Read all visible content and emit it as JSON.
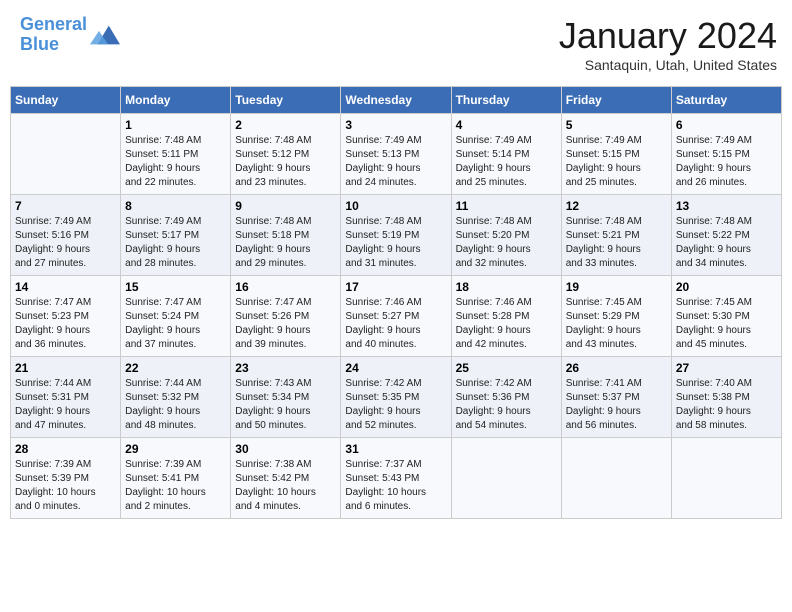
{
  "header": {
    "logo_line1": "General",
    "logo_line2": "Blue",
    "month_title": "January 2024",
    "location": "Santaquin, Utah, United States"
  },
  "days_of_week": [
    "Sunday",
    "Monday",
    "Tuesday",
    "Wednesday",
    "Thursday",
    "Friday",
    "Saturday"
  ],
  "weeks": [
    [
      {
        "day": "",
        "info": ""
      },
      {
        "day": "1",
        "info": "Sunrise: 7:48 AM\nSunset: 5:11 PM\nDaylight: 9 hours\nand 22 minutes."
      },
      {
        "day": "2",
        "info": "Sunrise: 7:48 AM\nSunset: 5:12 PM\nDaylight: 9 hours\nand 23 minutes."
      },
      {
        "day": "3",
        "info": "Sunrise: 7:49 AM\nSunset: 5:13 PM\nDaylight: 9 hours\nand 24 minutes."
      },
      {
        "day": "4",
        "info": "Sunrise: 7:49 AM\nSunset: 5:14 PM\nDaylight: 9 hours\nand 25 minutes."
      },
      {
        "day": "5",
        "info": "Sunrise: 7:49 AM\nSunset: 5:15 PM\nDaylight: 9 hours\nand 25 minutes."
      },
      {
        "day": "6",
        "info": "Sunrise: 7:49 AM\nSunset: 5:15 PM\nDaylight: 9 hours\nand 26 minutes."
      }
    ],
    [
      {
        "day": "7",
        "info": "Sunrise: 7:49 AM\nSunset: 5:16 PM\nDaylight: 9 hours\nand 27 minutes."
      },
      {
        "day": "8",
        "info": "Sunrise: 7:49 AM\nSunset: 5:17 PM\nDaylight: 9 hours\nand 28 minutes."
      },
      {
        "day": "9",
        "info": "Sunrise: 7:48 AM\nSunset: 5:18 PM\nDaylight: 9 hours\nand 29 minutes."
      },
      {
        "day": "10",
        "info": "Sunrise: 7:48 AM\nSunset: 5:19 PM\nDaylight: 9 hours\nand 31 minutes."
      },
      {
        "day": "11",
        "info": "Sunrise: 7:48 AM\nSunset: 5:20 PM\nDaylight: 9 hours\nand 32 minutes."
      },
      {
        "day": "12",
        "info": "Sunrise: 7:48 AM\nSunset: 5:21 PM\nDaylight: 9 hours\nand 33 minutes."
      },
      {
        "day": "13",
        "info": "Sunrise: 7:48 AM\nSunset: 5:22 PM\nDaylight: 9 hours\nand 34 minutes."
      }
    ],
    [
      {
        "day": "14",
        "info": "Sunrise: 7:47 AM\nSunset: 5:23 PM\nDaylight: 9 hours\nand 36 minutes."
      },
      {
        "day": "15",
        "info": "Sunrise: 7:47 AM\nSunset: 5:24 PM\nDaylight: 9 hours\nand 37 minutes."
      },
      {
        "day": "16",
        "info": "Sunrise: 7:47 AM\nSunset: 5:26 PM\nDaylight: 9 hours\nand 39 minutes."
      },
      {
        "day": "17",
        "info": "Sunrise: 7:46 AM\nSunset: 5:27 PM\nDaylight: 9 hours\nand 40 minutes."
      },
      {
        "day": "18",
        "info": "Sunrise: 7:46 AM\nSunset: 5:28 PM\nDaylight: 9 hours\nand 42 minutes."
      },
      {
        "day": "19",
        "info": "Sunrise: 7:45 AM\nSunset: 5:29 PM\nDaylight: 9 hours\nand 43 minutes."
      },
      {
        "day": "20",
        "info": "Sunrise: 7:45 AM\nSunset: 5:30 PM\nDaylight: 9 hours\nand 45 minutes."
      }
    ],
    [
      {
        "day": "21",
        "info": "Sunrise: 7:44 AM\nSunset: 5:31 PM\nDaylight: 9 hours\nand 47 minutes."
      },
      {
        "day": "22",
        "info": "Sunrise: 7:44 AM\nSunset: 5:32 PM\nDaylight: 9 hours\nand 48 minutes."
      },
      {
        "day": "23",
        "info": "Sunrise: 7:43 AM\nSunset: 5:34 PM\nDaylight: 9 hours\nand 50 minutes."
      },
      {
        "day": "24",
        "info": "Sunrise: 7:42 AM\nSunset: 5:35 PM\nDaylight: 9 hours\nand 52 minutes."
      },
      {
        "day": "25",
        "info": "Sunrise: 7:42 AM\nSunset: 5:36 PM\nDaylight: 9 hours\nand 54 minutes."
      },
      {
        "day": "26",
        "info": "Sunrise: 7:41 AM\nSunset: 5:37 PM\nDaylight: 9 hours\nand 56 minutes."
      },
      {
        "day": "27",
        "info": "Sunrise: 7:40 AM\nSunset: 5:38 PM\nDaylight: 9 hours\nand 58 minutes."
      }
    ],
    [
      {
        "day": "28",
        "info": "Sunrise: 7:39 AM\nSunset: 5:39 PM\nDaylight: 10 hours\nand 0 minutes."
      },
      {
        "day": "29",
        "info": "Sunrise: 7:39 AM\nSunset: 5:41 PM\nDaylight: 10 hours\nand 2 minutes."
      },
      {
        "day": "30",
        "info": "Sunrise: 7:38 AM\nSunset: 5:42 PM\nDaylight: 10 hours\nand 4 minutes."
      },
      {
        "day": "31",
        "info": "Sunrise: 7:37 AM\nSunset: 5:43 PM\nDaylight: 10 hours\nand 6 minutes."
      },
      {
        "day": "",
        "info": ""
      },
      {
        "day": "",
        "info": ""
      },
      {
        "day": "",
        "info": ""
      }
    ]
  ]
}
